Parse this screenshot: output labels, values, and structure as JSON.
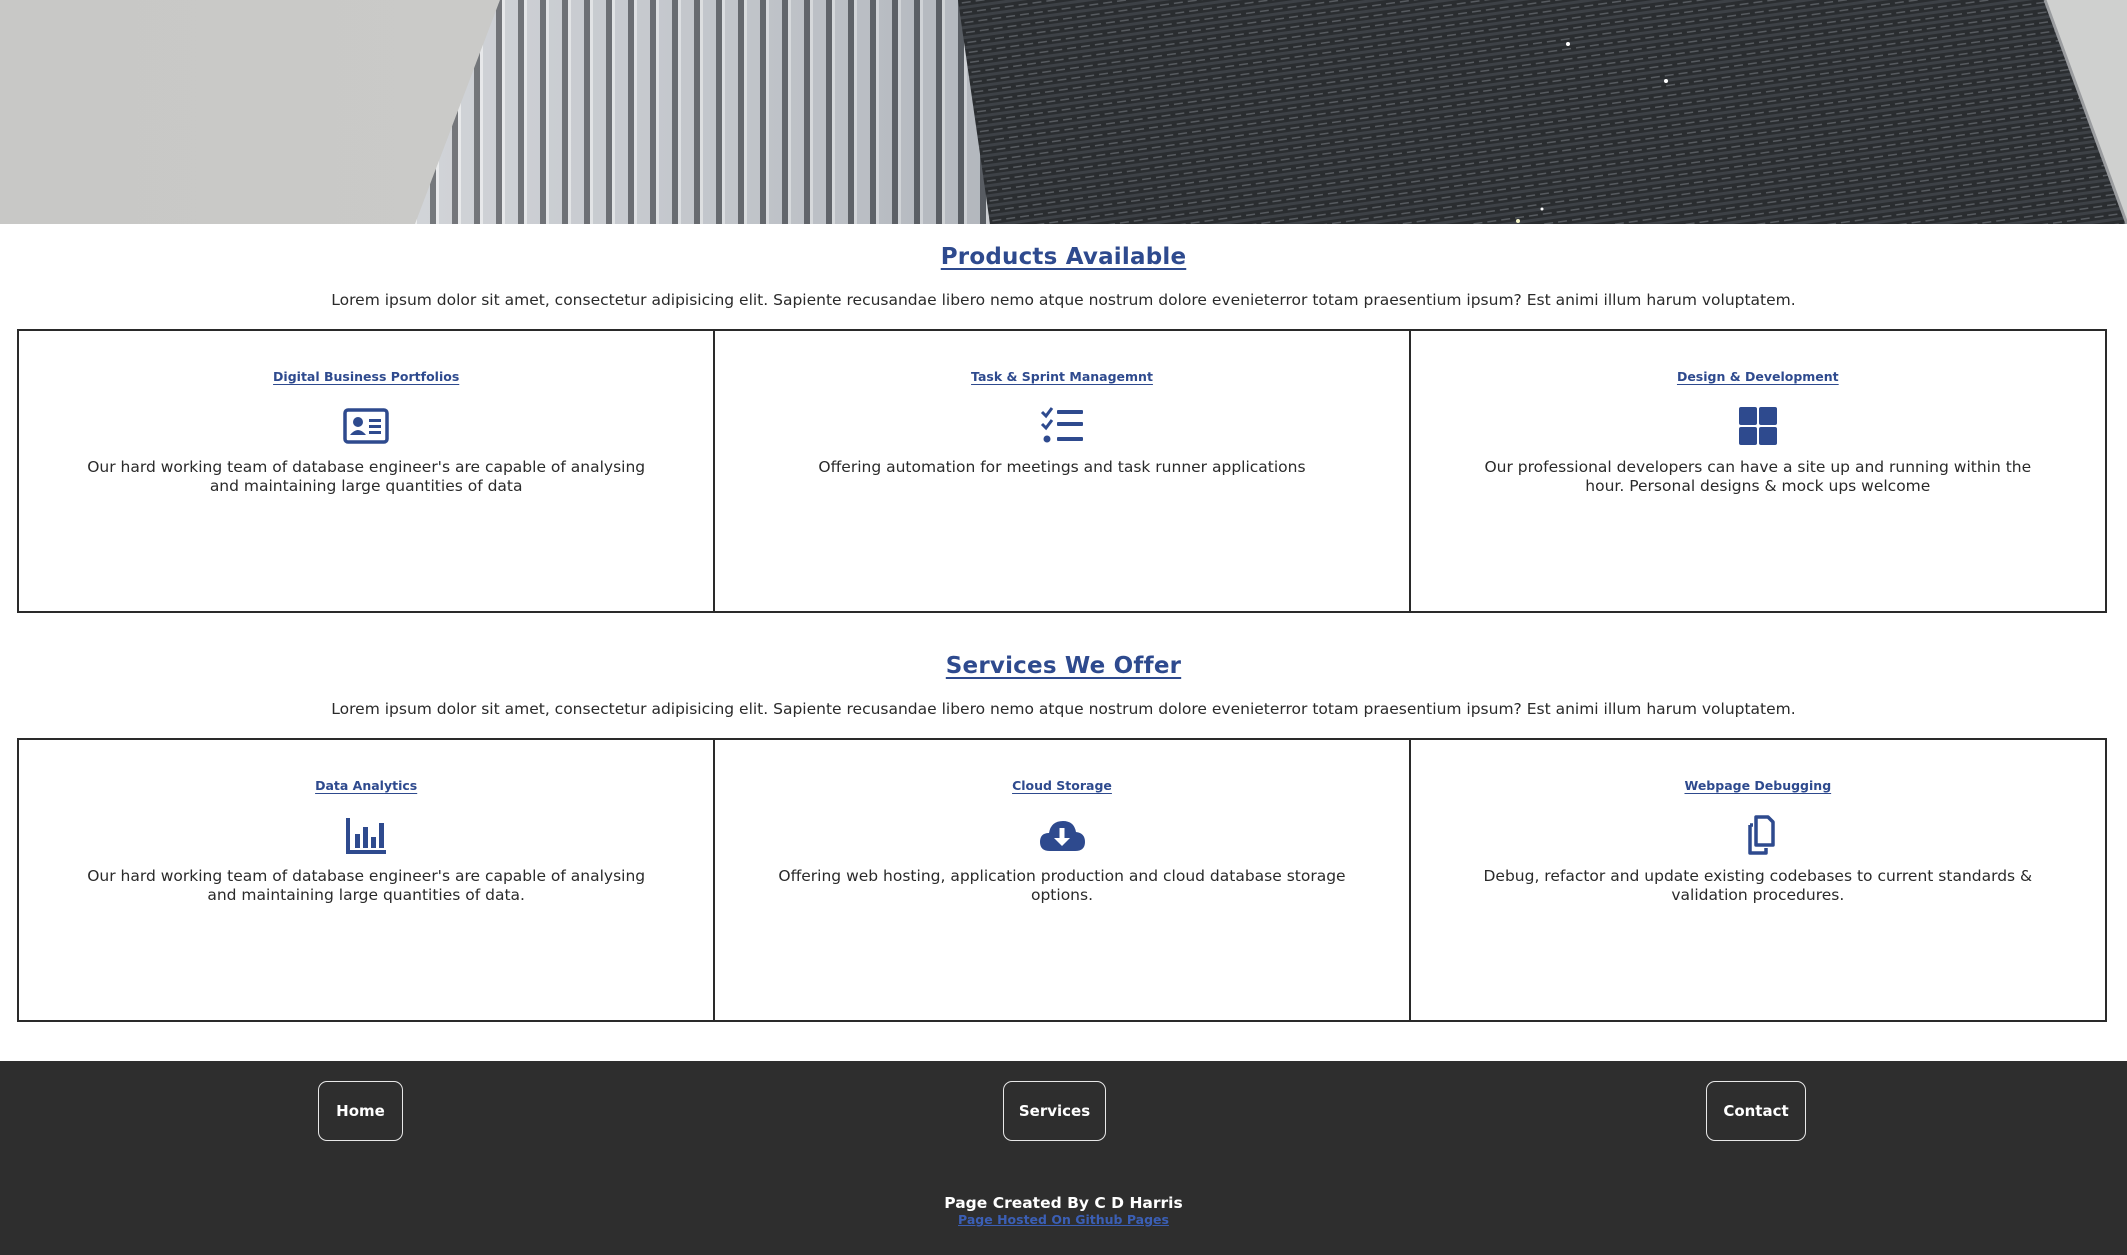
{
  "hero": {
    "image": "office-building-facade-photo"
  },
  "colors": {
    "accent": "#2e4a8e",
    "border": "#2a2a2a",
    "footer_bg": "#2e2e2e",
    "link": "#3b5fb5"
  },
  "products": {
    "title": "Products Available",
    "description": "Lorem ipsum dolor sit amet, consectetur adipisicing elit. Sapiente recusandae libero nemo atque nostrum dolore evenieterror totam praesentium ipsum? Est animi illum harum voluptatem.",
    "cards": [
      {
        "title": "Digital Business Portfolios",
        "icon": "id-card-icon",
        "text": "Our hard working team of database engineer's are capable of analysing and maintaining large quantities of data"
      },
      {
        "title": "Task & Sprint Managemnt",
        "icon": "task-list-icon",
        "text": "Offering automation for meetings and task runner applications"
      },
      {
        "title": "Design & Development",
        "icon": "grid-layout-icon",
        "text": "Our professional developers can have a site up and running within the hour. Personal designs & mock ups welcome"
      }
    ]
  },
  "services": {
    "title": "Services We Offer",
    "description": "Lorem ipsum dolor sit amet, consectetur adipisicing elit. Sapiente recusandae libero nemo atque nostrum dolore evenieterror totam praesentium ipsum? Est animi illum harum voluptatem.",
    "cards": [
      {
        "title": "Data Analytics",
        "icon": "bar-chart-icon",
        "text": "Our hard working team of database engineer's are capable of analysing and maintaining large quantities of data."
      },
      {
        "title": "Cloud Storage",
        "icon": "cloud-download-icon",
        "text": "Offering web hosting, application production and cloud database storage options."
      },
      {
        "title": "Webpage Debugging",
        "icon": "copy-files-icon",
        "text": "Debug, refactor and update existing codebases to current standards & validation procedures."
      }
    ]
  },
  "footer": {
    "nav": {
      "home": "Home",
      "services": "Services",
      "contact": "Contact"
    },
    "credit": "Page Created By C D Harris",
    "hosted_link": "Page Hosted On Github Pages"
  }
}
